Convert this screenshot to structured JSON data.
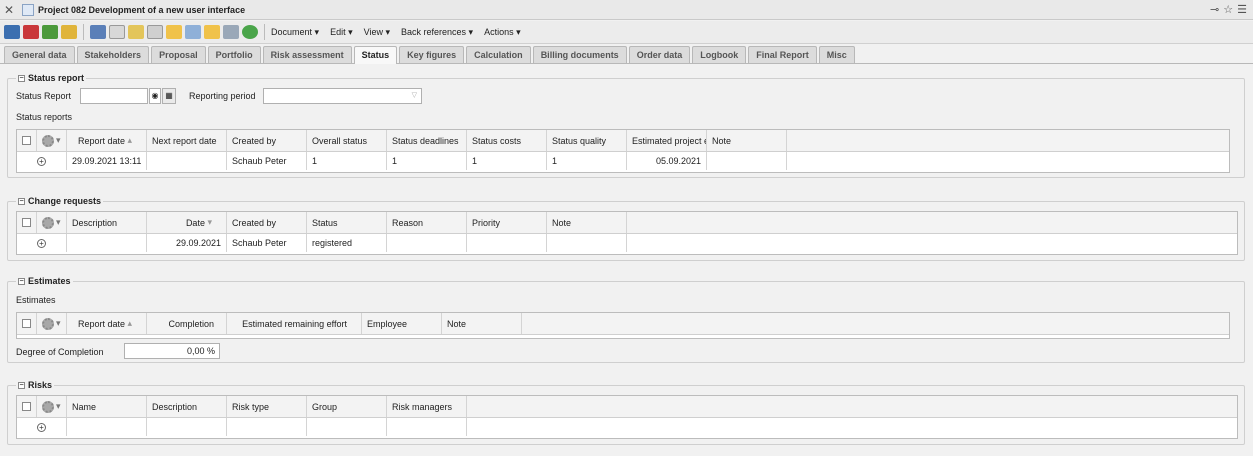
{
  "window": {
    "title": "Project 082 Development of a new user interface"
  },
  "menus": [
    "Document",
    "Edit",
    "View",
    "Back references",
    "Actions"
  ],
  "tabs": [
    "General data",
    "Stakeholders",
    "Proposal",
    "Portfolio",
    "Risk assessment",
    "Status",
    "Key figures",
    "Calculation",
    "Billing documents",
    "Order data",
    "Logbook",
    "Final Report",
    "Misc"
  ],
  "status": {
    "title": "Status report",
    "field_label": "Status Report",
    "period_label": "Reporting period",
    "grid_label": "Status reports",
    "columns": [
      "Report date",
      "Next report date",
      "Created by",
      "Overall status",
      "Status deadlines",
      "Status costs",
      "Status quality",
      "Estimated project e",
      "Note"
    ],
    "row": [
      "29.09.2021 13:11",
      "",
      "Schaub Peter",
      "1",
      "1",
      "1",
      "1",
      "05.09.2021",
      ""
    ]
  },
  "changes": {
    "title": "Change requests",
    "columns": [
      "Description",
      "Date",
      "Created by",
      "Status",
      "Reason",
      "Priority",
      "Note"
    ],
    "row": [
      "",
      "29.09.2021",
      "Schaub Peter",
      "registered",
      "",
      "",
      ""
    ]
  },
  "estimates": {
    "title": "Estimates",
    "grid_label": "Estimates",
    "columns": [
      "Report date",
      "Completion",
      "Estimated remaining effort",
      "Employee",
      "Note"
    ],
    "degree_label": "Degree of Completion",
    "degree_value": "0,00 %"
  },
  "risks": {
    "title": "Risks",
    "columns": [
      "Name",
      "Description",
      "Risk type",
      "Group",
      "Risk managers"
    ]
  }
}
